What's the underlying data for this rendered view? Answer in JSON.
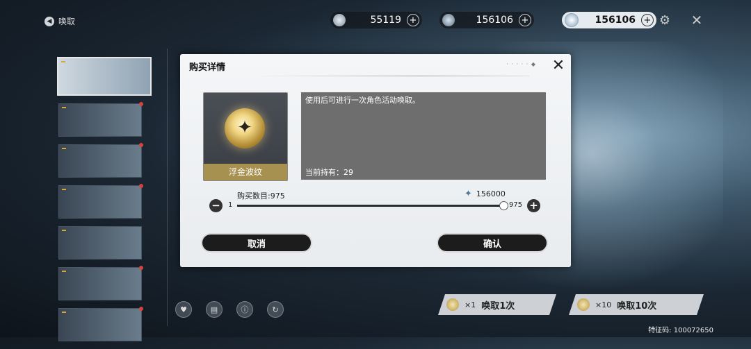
{
  "topbar": {
    "back_label": "唤取",
    "currencies": [
      {
        "value": "55119",
        "icon": "astrite-icon"
      },
      {
        "value": "156106",
        "icon": "lunite-icon"
      },
      {
        "value": "156106",
        "icon": "tide-icon"
      }
    ]
  },
  "modal": {
    "title": "购买详情",
    "item": {
      "name": "浮金波纹",
      "icon": "forging-tide-icon"
    },
    "description": "使用后可进行一次角色活动唤取。",
    "owned": "当前持有：29",
    "quantity_label": "购买数目:975",
    "cost": "156000",
    "slider": {
      "min_label": "1",
      "max_label": "975",
      "value": 975,
      "min": 1,
      "max": 975
    },
    "cancel": "取消",
    "confirm": "确认"
  },
  "pulls": [
    {
      "count": "×1",
      "label": "唤取1次"
    },
    {
      "count": "×10",
      "label": "唤取10次"
    }
  ],
  "feature_code": "特征码: 100072650"
}
